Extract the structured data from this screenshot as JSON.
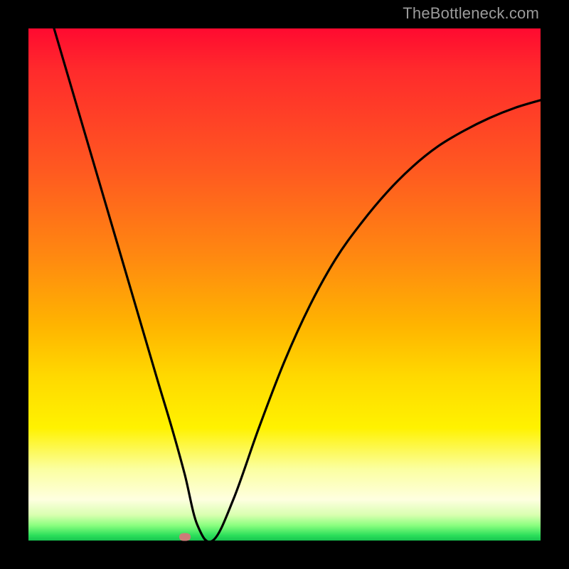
{
  "watermark": "TheBottleneck.com",
  "chart_data": {
    "type": "line",
    "title": "",
    "xlabel": "",
    "ylabel": "",
    "xlim": [
      0,
      100
    ],
    "ylim": [
      0,
      100
    ],
    "grid": false,
    "legend": false,
    "series": [
      {
        "name": "curve",
        "color": "#000000",
        "x": [
          5,
          10,
          15,
          20,
          25,
          28,
          30.5,
          33,
          36,
          40,
          45,
          50,
          55,
          60,
          65,
          70,
          75,
          80,
          85,
          90,
          95,
          100
        ],
        "values": [
          100,
          83,
          66,
          49,
          32,
          22,
          13,
          3,
          0,
          8,
          22,
          35,
          46,
          55,
          62,
          68,
          73,
          77,
          80,
          82.5,
          84.5,
          86
        ]
      }
    ],
    "marker": {
      "x": 30.5,
      "y": 0.7,
      "color": "#cc7b78"
    }
  },
  "gradient_colors": {
    "top": "#ff0a30",
    "mid_upper": "#ff8a10",
    "mid": "#ffd900",
    "mid_lower": "#fbffa0",
    "bottom": "#18c450"
  }
}
